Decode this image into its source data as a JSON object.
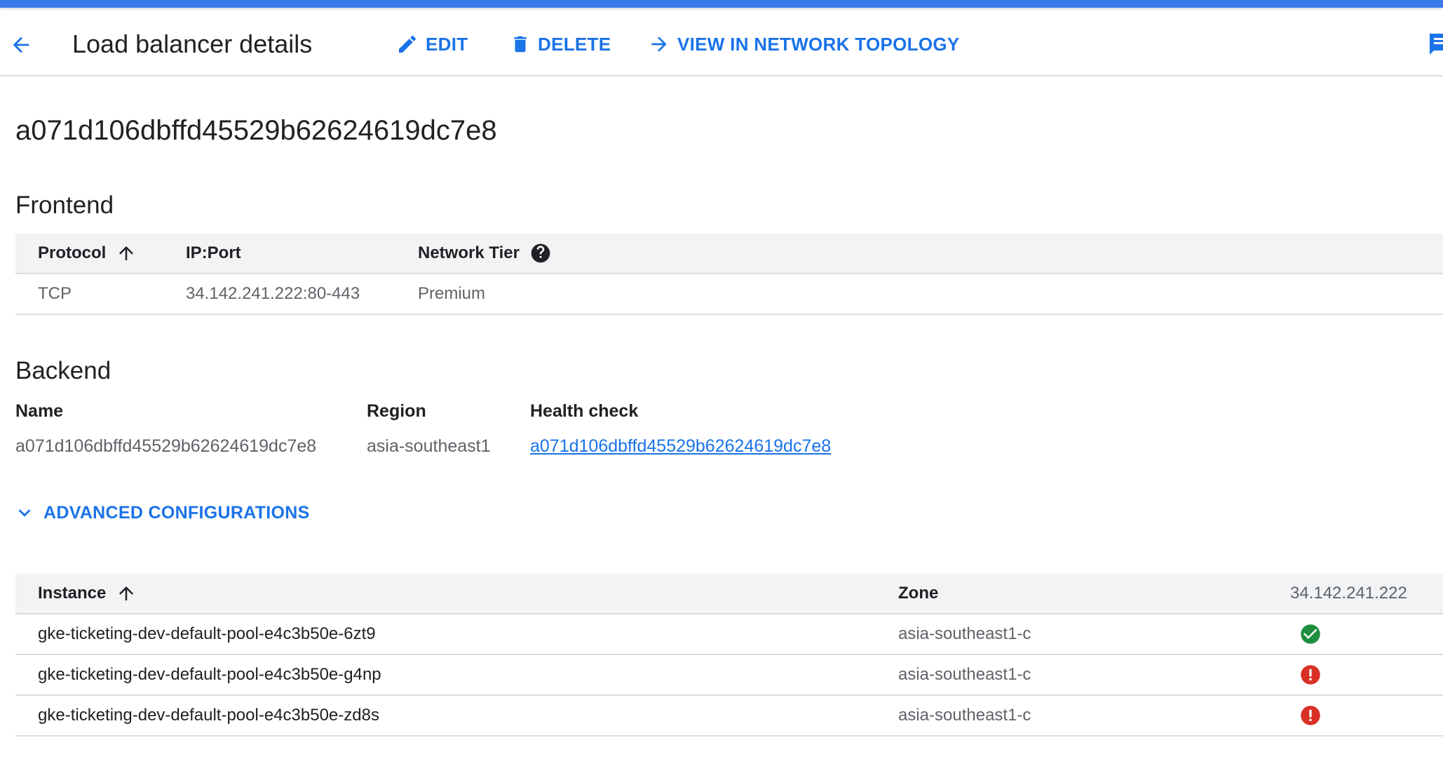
{
  "header": {
    "title": "Load balancer details",
    "actions": {
      "edit": "EDIT",
      "delete": "DELETE",
      "topology": "VIEW IN NETWORK TOPOLOGY"
    }
  },
  "resource_name": "a071d106dbffd45529b62624619dc7e8",
  "frontend": {
    "title": "Frontend",
    "columns": {
      "protocol": "Protocol",
      "ip_port": "IP:Port",
      "network_tier": "Network Tier"
    },
    "rows": [
      {
        "protocol": "TCP",
        "ip_port": "34.142.241.222:80-443",
        "network_tier": "Premium"
      }
    ]
  },
  "backend": {
    "title": "Backend",
    "labels": {
      "name": "Name",
      "region": "Region",
      "health_check": "Health check"
    },
    "values": {
      "name": "a071d106dbffd45529b62624619dc7e8",
      "region": "asia-southeast1",
      "health_check": "a071d106dbffd45529b62624619dc7e8"
    }
  },
  "advanced_toggle": "ADVANCED CONFIGURATIONS",
  "instances": {
    "columns": {
      "instance": "Instance",
      "zone": "Zone",
      "ip": "34.142.241.222"
    },
    "rows": [
      {
        "instance": "gke-ticketing-dev-default-pool-e4c3b50e-6zt9",
        "zone": "asia-southeast1-c",
        "status": "healthy"
      },
      {
        "instance": "gke-ticketing-dev-default-pool-e4c3b50e-g4np",
        "zone": "asia-southeast1-c",
        "status": "unhealthy"
      },
      {
        "instance": "gke-ticketing-dev-default-pool-e4c3b50e-zd8s",
        "zone": "asia-southeast1-c",
        "status": "unhealthy"
      }
    ]
  },
  "colors": {
    "accent": "#1a73e8",
    "top_bar": "#3b78e7",
    "healthy": "#1e8e3e",
    "unhealthy": "#d93025"
  },
  "icons": {
    "back": "arrow-back-icon",
    "edit": "pencil-icon",
    "delete": "trash-icon",
    "topology": "arrow-forward-icon",
    "sort": "arrow-up-icon",
    "help": "help-circle-icon",
    "expand": "chevron-down-icon",
    "healthy": "check-circle-icon",
    "unhealthy": "error-circle-icon",
    "corner": "feedback-icon"
  }
}
